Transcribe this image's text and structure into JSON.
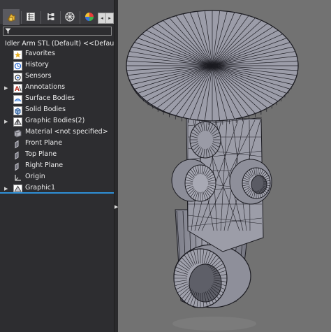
{
  "feature_manager": {
    "tabs": [
      {
        "icon": "feature-manager-icon"
      },
      {
        "icon": "property-manager-icon"
      },
      {
        "icon": "configuration-manager-icon"
      },
      {
        "icon": "dimxpert-manager-icon"
      },
      {
        "icon": "display-manager-icon"
      }
    ],
    "tab_scroll": {
      "left": "◂",
      "right": "▸"
    },
    "filter_icon": "filter-icon",
    "root": {
      "label": "Idler Arm STL (Default) <<Default>_Di",
      "icon": "part-icon"
    },
    "tree": [
      {
        "label": "Favorites",
        "icon": "favorites-icon",
        "expander": ""
      },
      {
        "label": "History",
        "icon": "history-icon",
        "expander": ""
      },
      {
        "label": "Sensors",
        "icon": "sensors-icon",
        "expander": ""
      },
      {
        "label": "Annotations",
        "icon": "annotations-icon",
        "expander": "▶"
      },
      {
        "label": "Surface Bodies",
        "icon": "surface-bodies-icon",
        "expander": ""
      },
      {
        "label": "Solid Bodies",
        "icon": "solid-bodies-icon",
        "expander": ""
      },
      {
        "label": "Graphic Bodies(2)",
        "icon": "graphic-bodies-icon",
        "expander": "▶"
      },
      {
        "label": "Material <not specified>",
        "icon": "material-icon",
        "expander": ""
      },
      {
        "label": "Front Plane",
        "icon": "plane-icon",
        "expander": ""
      },
      {
        "label": "Top Plane",
        "icon": "plane-icon",
        "expander": ""
      },
      {
        "label": "Right Plane",
        "icon": "plane-icon",
        "expander": ""
      },
      {
        "label": "Origin",
        "icon": "origin-icon",
        "expander": ""
      },
      {
        "label": "Graphic1",
        "icon": "graphic-body-icon",
        "expander": "▶"
      }
    ],
    "splitter_arrow": "▶"
  },
  "colors": {
    "panel_bg": "#2d2d30",
    "viewport_bg": "#727272",
    "accent": "#2e8fd6",
    "mesh_fill": "#9a9ba6",
    "mesh_edge": "#1c1c22"
  }
}
